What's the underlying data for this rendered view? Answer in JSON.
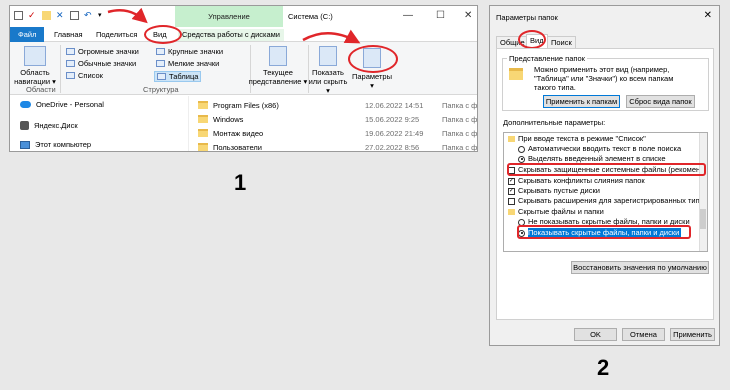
{
  "explorer": {
    "context_tab_header": "Управление",
    "window_title": "Система (C:)",
    "tabs": [
      "Файл",
      "Главная",
      "Поделиться",
      "Вид",
      "Средства работы с дисками"
    ],
    "ribbon": {
      "nav_pane_label_1": "Область",
      "nav_pane_label_2": "навигации",
      "group_areas": "Области",
      "layout_items": [
        "Огромные значки",
        "Крупные значки",
        "Обычные значки",
        "Мелкие значки",
        "Список",
        "Таблица"
      ],
      "group_structure": "Структура",
      "current_view_1": "Текущее",
      "current_view_2": "представление",
      "show_hide_1": "Показать",
      "show_hide_2": "или скрыть",
      "options": "Параметры"
    },
    "nav_items": [
      "OneDrive - Personal",
      "Яндекс.Диск",
      "Этот компьютер"
    ],
    "files": [
      {
        "name": "Program Files (x86)",
        "date": "12.06.2022 14:51",
        "type": "Папка с фай"
      },
      {
        "name": "Windows",
        "date": "15.06.2022 9:25",
        "type": "Папка с фай"
      },
      {
        "name": "Монтаж видео",
        "date": "19.06.2022 21:49",
        "type": "Папка с фай"
      },
      {
        "name": "Пользователи",
        "date": "27.02.2022 8:56",
        "type": "Папка с фай"
      }
    ]
  },
  "dialog": {
    "title": "Параметры папок",
    "tabs": [
      "Общие",
      "Вид",
      "Поиск"
    ],
    "folder_view_legend": "Представление папок",
    "folder_view_text": [
      "Можно применить этот вид (например,",
      "\"Таблица\" или \"Значки\") ко всем папкам",
      "такого типа."
    ],
    "apply_button": "Применить к папкам",
    "reset_button": "Сброс вида папок",
    "advanced_label": "Дополнительные параметры:",
    "tree": [
      "При вводе текста в режиме \"Список\"",
      "Автоматически вводить текст в поле поиска",
      "Выделять введенный элемент в списке",
      "Скрывать защищенные системные файлы (рекомен...",
      "Скрывать конфликты слияния папок",
      "Скрывать пустые диски",
      "Скрывать расширения для зарегистрированных типо",
      "Скрытые файлы и папки",
      "Не показывать скрытые файлы, папки и диски",
      "Показывать скрытые файлы, папки и диски"
    ],
    "restore_button": "Восстановить значения по умолчанию",
    "ok_button": "OK",
    "cancel_button": "Отмена",
    "apply_footer_button": "Применить"
  },
  "labels": {
    "step1": "1",
    "step2": "2"
  },
  "colors": {
    "accent": "#1979ca",
    "annotation": "#e0262a",
    "context_tab": "#c6efce"
  }
}
